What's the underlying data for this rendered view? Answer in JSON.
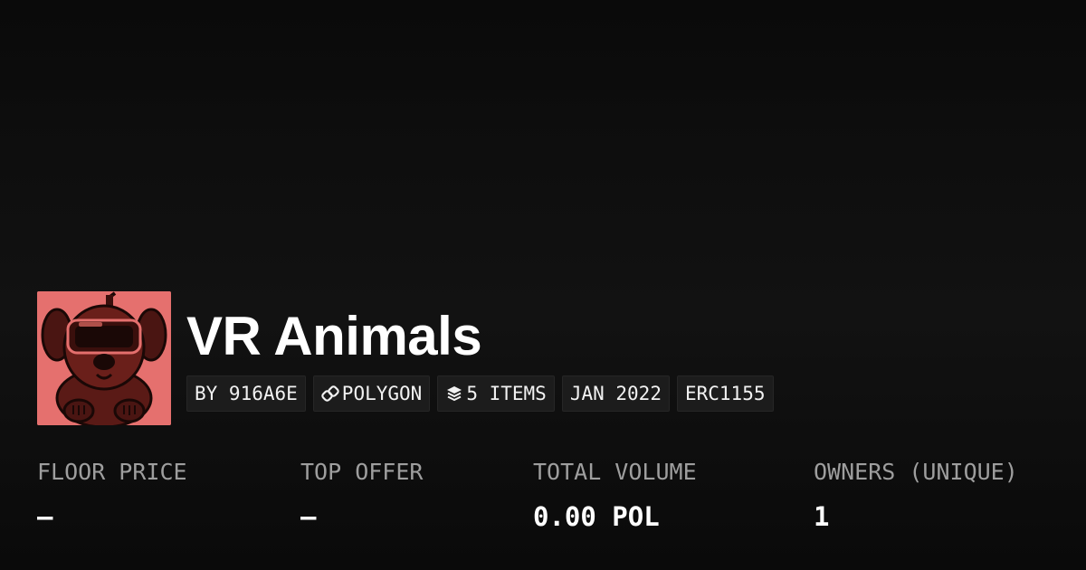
{
  "collection": {
    "name": "VR Animals",
    "avatar_icon": "vr-dog-icon",
    "avatar_bg": "#e5706e"
  },
  "tags": {
    "creator": "BY 916A6E",
    "chain": "POLYGON",
    "chain_icon": "link-icon",
    "items": "5 ITEMS",
    "items_icon": "layers-icon",
    "date": "JAN 2022",
    "standard": "ERC1155"
  },
  "stats": {
    "floor_price": {
      "label": "FLOOR PRICE",
      "value": "–"
    },
    "top_offer": {
      "label": "TOP OFFER",
      "value": "–"
    },
    "total_volume": {
      "label": "TOTAL VOLUME",
      "value": "0.00 POL"
    },
    "owners": {
      "label": "OWNERS (UNIQUE)",
      "value": "1"
    }
  },
  "colors": {
    "background": "#0a0a0a",
    "tag_background": "#1c1c1c",
    "label": "#9e9e9e",
    "text": "#ffffff"
  }
}
